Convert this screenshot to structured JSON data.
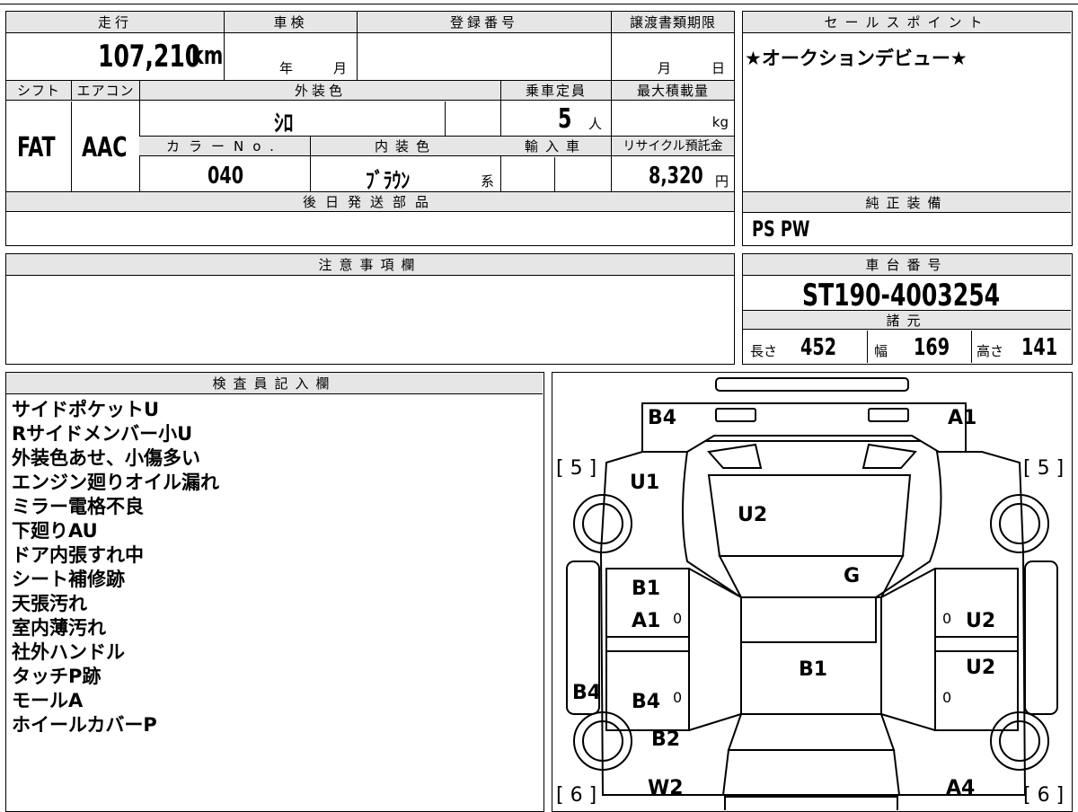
{
  "vehicle": {
    "mileage_header": "走行",
    "mileage_value": "107,210",
    "mileage_unit": "km",
    "inspection_header": "車検",
    "inspection_year": "年",
    "inspection_month": "月",
    "registration_header": "登録番号",
    "transfer_header": "譲渡書類期限",
    "transfer_month": "月",
    "transfer_day": "日",
    "shift_header": "シフト",
    "shift_value": "FAT",
    "ac_header": "エアコン",
    "ac_value": "AAC",
    "exterior_header": "外装色",
    "exterior_value": "ｼﾛ",
    "capacity_header": "乗車定員",
    "capacity_value": "5",
    "capacity_unit": "人",
    "max_load_header": "最大積載量",
    "max_load_unit": "kg",
    "color_no_header": "カラーNo.",
    "color_no_value": "040",
    "interior_header": "内装色",
    "interior_value": "ﾌﾞﾗｳﾝ",
    "interior_suffix": "系",
    "import_header": "輸入車",
    "recycle_header": "リサイクル預託金",
    "recycle_value": "8,320",
    "recycle_unit": "円",
    "later_parts_header": "後日発送部品"
  },
  "sales_point": {
    "header": "セールスポイント",
    "text": "★オークションデビュー★"
  },
  "equipment": {
    "header": "純正装備",
    "text": "PS PW"
  },
  "caution": {
    "header": "注意事項欄"
  },
  "chassis": {
    "header": "車台番号",
    "value": "ST190-4003254",
    "spec_header": "諸元",
    "length_label": "長さ",
    "length_value": "452",
    "width_label": "幅",
    "width_value": "169",
    "height_label": "高さ",
    "height_value": "141"
  },
  "inspector": {
    "header": "検査員記入欄",
    "notes": [
      "サイドポケットU",
      "Rサイドメンバー小U",
      "外装色あせ、小傷多い",
      "エンジン廻りオイル漏れ",
      "ミラー電格不良",
      "下廻りAU",
      "ドア内張すれ中",
      "シート補修跡",
      "天張汚れ",
      "室内薄汚れ",
      "社外ハンドル",
      "タッチP跡",
      "モールA",
      "ホイールカバーP"
    ]
  },
  "diagram": {
    "tread_front_left": "[ 5 ]",
    "tread_front_right": "[ 5 ]",
    "tread_rear_left": "[ 6 ]",
    "tread_rear_right": "[ 6 ]",
    "marks": {
      "front_bumper_left": "B4",
      "front_bumper_right": "A1",
      "fender_front_left": "U1",
      "hood": "U2",
      "windshield": "G",
      "left_front_door_1": "B1",
      "left_front_door_2": "A1",
      "right_front_door": "U2",
      "roof": "B1",
      "right_rear_door": "U2",
      "left_rear_quarter": "B4",
      "left_rear_door": "B4",
      "left_rear_fender": "B2",
      "rear_left": "W2",
      "rear_right": "A4"
    },
    "zero_marks": [
      "0",
      "0",
      "0",
      "0"
    ]
  }
}
